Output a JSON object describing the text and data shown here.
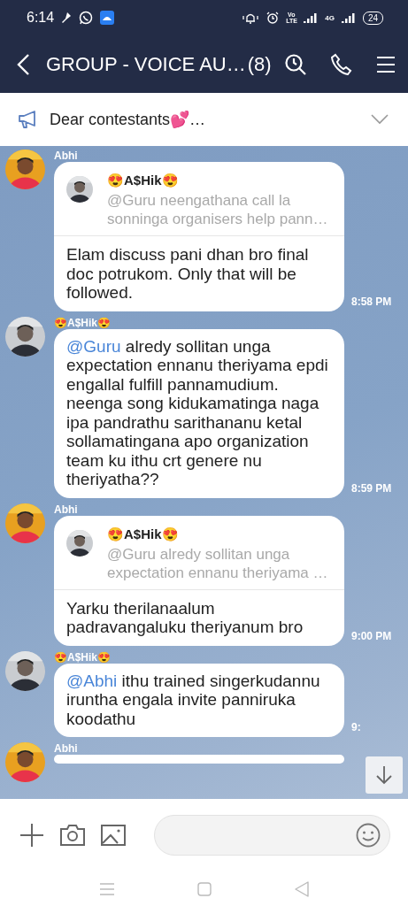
{
  "status_bar": {
    "time": "6:14",
    "volte": "Vo LTE",
    "network": "4G",
    "battery": "24"
  },
  "header": {
    "title": "GROUP - VOICE AU…",
    "count": "(8)"
  },
  "notice": {
    "text": "Dear contestants💕…",
    "expanded": false
  },
  "messages": [
    {
      "sender": "Abhi",
      "quote": {
        "sender": "😍A$Hik😍",
        "text": "@Guru neengathana call la sonninga organisers help pann…"
      },
      "text": "Elam discuss pani dhan bro final doc potrukom. Only that will be followed.",
      "time": "8:58 PM"
    },
    {
      "sender": "😍A$Hik😍",
      "mention": "@Guru",
      "text": " alredy sollitan unga expectation ennanu theriyama epdi engallal fulfill pannamudium. neenga song kidukamatinga naga ipa pandrathu sarithananu ketal sollamatingana apo organization team ku ithu crt genere nu theriyatha??",
      "time": "8:59 PM"
    },
    {
      "sender": "Abhi",
      "quote": {
        "sender": "😍A$Hik😍",
        "text": "@Guru alredy sollitan unga expectation ennanu theriyama …"
      },
      "text": "Yarku therilanaalum padravangaluku theriyanum bro",
      "time": "9:00 PM"
    },
    {
      "sender": "😍A$Hik😍",
      "mention": "@Abhi",
      "text": " ithu trained singerkudannu iruntha engala invite panniruka koodathu",
      "time": "9:"
    },
    {
      "sender": "Abhi"
    }
  ]
}
